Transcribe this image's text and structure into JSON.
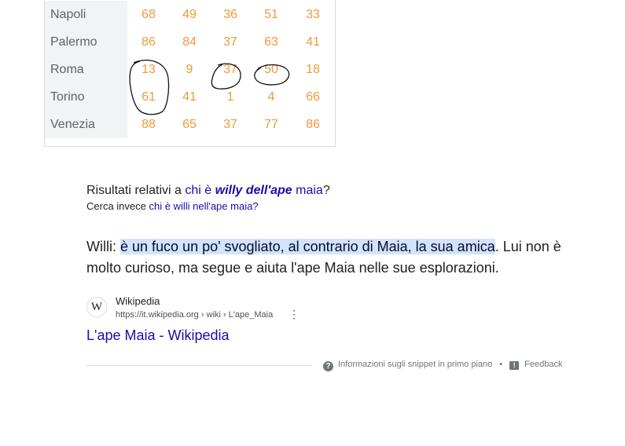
{
  "table": {
    "rows": [
      {
        "city": "Napoli",
        "values": [
          "68",
          "49",
          "36",
          "51",
          "33"
        ]
      },
      {
        "city": "Palermo",
        "values": [
          "86",
          "84",
          "37",
          "63",
          "41"
        ]
      },
      {
        "city": "Roma",
        "values": [
          "13",
          "9",
          "37",
          "50",
          "18"
        ]
      },
      {
        "city": "Torino",
        "values": [
          "61",
          "41",
          "1",
          "4",
          "66"
        ]
      },
      {
        "city": "Venezia",
        "values": [
          "88",
          "65",
          "37",
          "77",
          "86"
        ]
      }
    ]
  },
  "correction": {
    "prefix": "Risultati relativi a ",
    "link_plain_1": "chi è ",
    "link_bold": "willy dell'ape",
    "link_plain_2": " maia",
    "suffix": "?",
    "alt_prefix": "Cerca invece ",
    "alt_link": "chi è willi nell'ape maia?"
  },
  "snippet": {
    "lead": "Willi: ",
    "highlight": "è un fuco un po' svogliato, al contrario di Maia, la sua amica",
    "rest": ". Lui non è molto curioso, ma segue e aiuta l'ape Maia nelle sue esplorazioni."
  },
  "source": {
    "favicon": "W",
    "site_name": "Wikipedia",
    "url": "https://it.wikipedia.org › wiki › L'ape_Maia",
    "more_icon": "⋮"
  },
  "result": {
    "title": "L'ape Maia - Wikipedia"
  },
  "footer": {
    "about": "Informazioni sugli snippet in primo piano",
    "separator": "•",
    "feedback": "Feedback"
  },
  "colors": {
    "number": "#f29937",
    "link": "#1a0dab",
    "highlight": "#d3e3fd"
  }
}
